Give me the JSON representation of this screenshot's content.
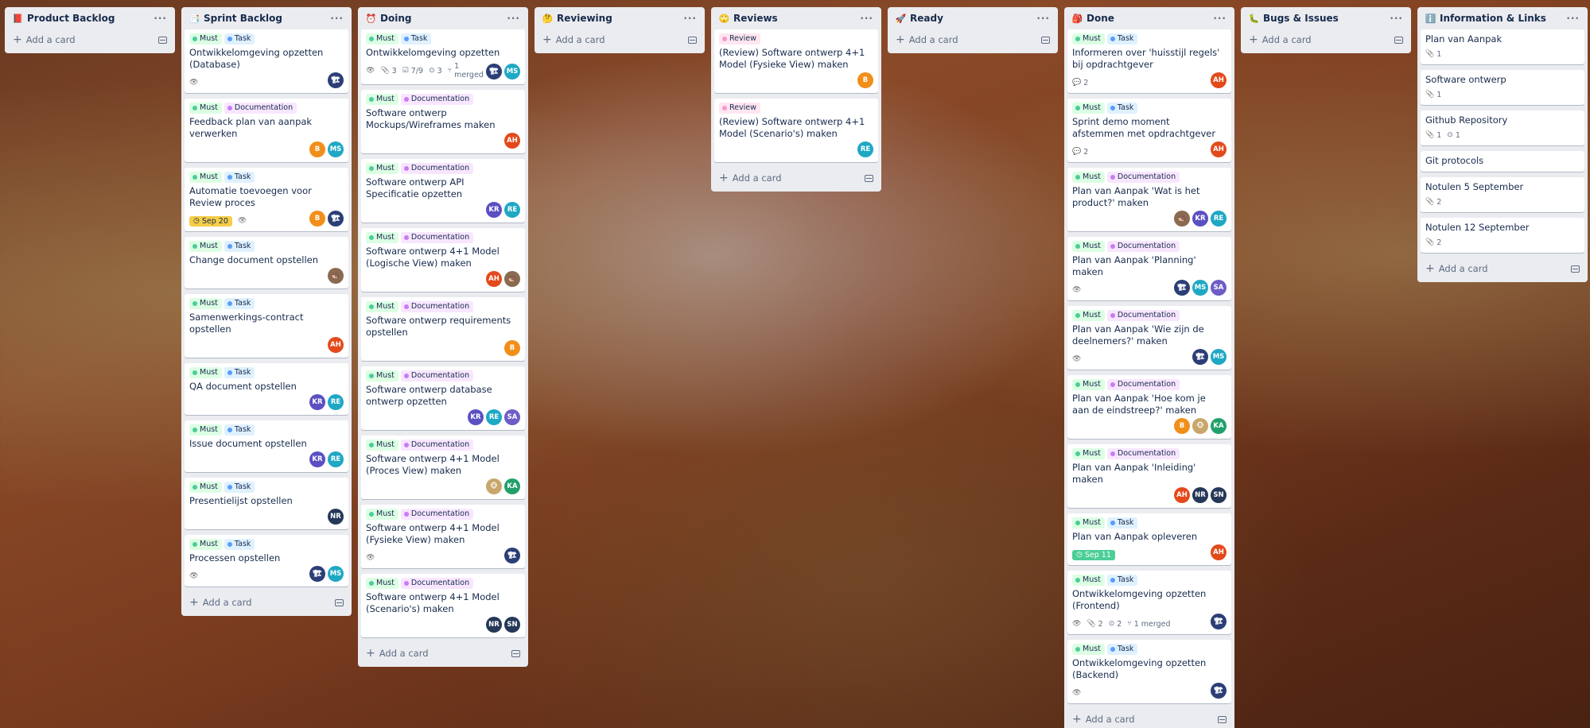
{
  "colors": {
    "must": "#4bce97",
    "task": "#579dff",
    "documentation": "#c97cf4",
    "review": "#f797d2"
  },
  "add_card_label": "Add a card",
  "lists": [
    {
      "title": "Product Backlog",
      "icon": "📕",
      "cards": []
    },
    {
      "title": "Sprint Backlog",
      "icon": "📑",
      "cards": [
        {
          "labels": [
            "Must",
            "Task"
          ],
          "title": "Ontwikkelomgeving opzetten (Database)",
          "badges": {
            "watch": true
          },
          "members": [
            {
              "i": "🏗",
              "c": "#2c3e76"
            }
          ]
        },
        {
          "labels": [
            "Must",
            "Documentation"
          ],
          "title": "Feedback plan van aanpak verwerken",
          "badges": {},
          "members": [
            {
              "i": "B",
              "c": "#f18f1a"
            },
            {
              "i": "MS",
              "c": "#1fa8c4"
            }
          ]
        },
        {
          "labels": [
            "Must",
            "Task"
          ],
          "title": "Automatie toevoegen voor Review proces",
          "badges": {
            "watch": true,
            "due": "Sep 20",
            "due_color": "yellow"
          },
          "members": [
            {
              "i": "B",
              "c": "#f18f1a"
            },
            {
              "i": "🏗",
              "c": "#2c3e76"
            }
          ]
        },
        {
          "labels": [
            "Must",
            "Task"
          ],
          "title": "Change document opstellen",
          "badges": {},
          "members": [
            {
              "i": "🦔",
              "c": "#8a6a50"
            }
          ]
        },
        {
          "labels": [
            "Must",
            "Task"
          ],
          "title": "Samenwerkings-contract opstellen",
          "badges": {},
          "members": [
            {
              "i": "AH",
              "c": "#e34a1b"
            }
          ]
        },
        {
          "labels": [
            "Must",
            "Task"
          ],
          "title": "QA document opstellen",
          "badges": {},
          "members": [
            {
              "i": "KR",
              "c": "#5b4fc2"
            },
            {
              "i": "RE",
              "c": "#1fa8c4"
            }
          ]
        },
        {
          "labels": [
            "Must",
            "Task"
          ],
          "title": "Issue document opstellen",
          "badges": {},
          "members": [
            {
              "i": "KR",
              "c": "#5b4fc2"
            },
            {
              "i": "RE",
              "c": "#1fa8c4"
            }
          ]
        },
        {
          "labels": [
            "Must",
            "Task"
          ],
          "title": "Presentielijst opstellen",
          "badges": {},
          "members": [
            {
              "i": "NR",
              "c": "#253858"
            }
          ]
        },
        {
          "labels": [
            "Must",
            "Task"
          ],
          "title": "Processen opstellen",
          "badges": {
            "watch": true
          },
          "members": [
            {
              "i": "🏗",
              "c": "#2c3e76"
            },
            {
              "i": "MS",
              "c": "#1fa8c4"
            }
          ]
        }
      ]
    },
    {
      "title": "Doing",
      "icon": "⏰",
      "cards": [
        {
          "labels": [
            "Must",
            "Task"
          ],
          "title": "Ontwikkelomgeving opzetten",
          "badges": {
            "watch": true,
            "attachments": "3",
            "checklist": "7/9",
            "github": "3",
            "merged": "1 merged"
          },
          "members": [
            {
              "i": "🏗",
              "c": "#2c3e76"
            },
            {
              "i": "MS",
              "c": "#1fa8c4"
            }
          ]
        },
        {
          "labels": [
            "Must",
            "Documentation"
          ],
          "title": "Software ontwerp Mockups/Wireframes maken",
          "badges": {},
          "members": [
            {
              "i": "AH",
              "c": "#e34a1b"
            }
          ]
        },
        {
          "labels": [
            "Must",
            "Documentation"
          ],
          "title": "Software ontwerp API Specificatie opzetten",
          "badges": {},
          "members": [
            {
              "i": "KR",
              "c": "#5b4fc2"
            },
            {
              "i": "RE",
              "c": "#1fa8c4"
            }
          ]
        },
        {
          "labels": [
            "Must",
            "Documentation"
          ],
          "title": "Software ontwerp 4+1 Model (Logische View) maken",
          "badges": {},
          "members": [
            {
              "i": "AH",
              "c": "#e34a1b"
            },
            {
              "i": "🦔",
              "c": "#8a6a50"
            }
          ]
        },
        {
          "labels": [
            "Must",
            "Documentation"
          ],
          "title": "Software ontwerp requirements opstellen",
          "badges": {},
          "members": [
            {
              "i": "B",
              "c": "#f18f1a"
            }
          ]
        },
        {
          "labels": [
            "Must",
            "Documentation"
          ],
          "title": "Software ontwerp database ontwerp opzetten",
          "badges": {},
          "members": [
            {
              "i": "KR",
              "c": "#5b4fc2"
            },
            {
              "i": "RE",
              "c": "#1fa8c4"
            },
            {
              "i": "SA",
              "c": "#6e5dc6"
            }
          ]
        },
        {
          "labels": [
            "Must",
            "Documentation"
          ],
          "title": "Software ontwerp 4+1 Model (Proces View) maken",
          "badges": {},
          "members": [
            {
              "i": "🐵",
              "c": "#c9a66b"
            },
            {
              "i": "KA",
              "c": "#22a06b"
            }
          ]
        },
        {
          "labels": [
            "Must",
            "Documentation"
          ],
          "title": "Software ontwerp 4+1 Model (Fysieke View) maken",
          "badges": {
            "watch": true
          },
          "members": [
            {
              "i": "🏗",
              "c": "#2c3e76"
            }
          ]
        },
        {
          "labels": [
            "Must",
            "Documentation"
          ],
          "title": "Software ontwerp 4+1 Model (Scenario's) maken",
          "badges": {},
          "members": [
            {
              "i": "NR",
              "c": "#253858"
            },
            {
              "i": "SN",
              "c": "#253858"
            }
          ]
        }
      ]
    },
    {
      "title": "Reviewing",
      "icon": "🤔",
      "cards": []
    },
    {
      "title": "Reviews",
      "icon": "🙄",
      "cards": [
        {
          "labels": [
            "Review"
          ],
          "title": "(Review) Software ontwerp 4+1 Model (Fysieke View) maken",
          "badges": {},
          "members": [
            {
              "i": "B",
              "c": "#f18f1a"
            }
          ]
        },
        {
          "labels": [
            "Review"
          ],
          "title": "(Review) Software ontwerp 4+1 Model (Scenario's) maken",
          "badges": {},
          "members": [
            {
              "i": "RE",
              "c": "#1fa8c4"
            }
          ]
        }
      ]
    },
    {
      "title": "Ready",
      "icon": "🚀",
      "cards": []
    },
    {
      "title": "Done",
      "icon": "🎒",
      "cards": [
        {
          "labels": [
            "Must",
            "Task"
          ],
          "title": "Informeren over 'huisstijl regels' bij opdrachtgever",
          "badges": {
            "comments": "2"
          },
          "members": [
            {
              "i": "AH",
              "c": "#e34a1b"
            }
          ]
        },
        {
          "labels": [
            "Must",
            "Task"
          ],
          "title": "Sprint demo moment afstemmen met opdrachtgever",
          "badges": {
            "comments": "2"
          },
          "members": [
            {
              "i": "AH",
              "c": "#e34a1b"
            }
          ]
        },
        {
          "labels": [
            "Must",
            "Documentation"
          ],
          "title": "Plan van Aanpak 'Wat is het product?' maken",
          "badges": {},
          "members": [
            {
              "i": "🦔",
              "c": "#8a6a50"
            },
            {
              "i": "KR",
              "c": "#5b4fc2"
            },
            {
              "i": "RE",
              "c": "#1fa8c4"
            }
          ]
        },
        {
          "labels": [
            "Must",
            "Documentation"
          ],
          "title": "Plan van Aanpak 'Planning' maken",
          "badges": {
            "watch": true
          },
          "members": [
            {
              "i": "🏗",
              "c": "#2c3e76"
            },
            {
              "i": "MS",
              "c": "#1fa8c4"
            },
            {
              "i": "SA",
              "c": "#6e5dc6"
            }
          ]
        },
        {
          "labels": [
            "Must",
            "Documentation"
          ],
          "title": "Plan van Aanpak 'Wie zijn de deelnemers?' maken",
          "badges": {
            "watch": true
          },
          "members": [
            {
              "i": "🏗",
              "c": "#2c3e76"
            },
            {
              "i": "MS",
              "c": "#1fa8c4"
            }
          ]
        },
        {
          "labels": [
            "Must",
            "Documentation"
          ],
          "title": "Plan van Aanpak 'Hoe kom je aan de eindstreep?' maken",
          "badges": {},
          "members": [
            {
              "i": "B",
              "c": "#f18f1a"
            },
            {
              "i": "🐵",
              "c": "#c9a66b"
            },
            {
              "i": "KA",
              "c": "#22a06b"
            }
          ]
        },
        {
          "labels": [
            "Must",
            "Documentation"
          ],
          "title": "Plan van Aanpak 'Inleiding' maken",
          "badges": {},
          "members": [
            {
              "i": "AH",
              "c": "#e34a1b"
            },
            {
              "i": "NR",
              "c": "#253858"
            },
            {
              "i": "SN",
              "c": "#253858"
            }
          ]
        },
        {
          "labels": [
            "Must",
            "Task"
          ],
          "title": "Plan van Aanpak opleveren",
          "badges": {
            "due": "Sep 11",
            "due_color": "green"
          },
          "members": [
            {
              "i": "AH",
              "c": "#e34a1b"
            }
          ]
        },
        {
          "labels": [
            "Must",
            "Task"
          ],
          "title": "Ontwikkelomgeving opzetten (Frontend)",
          "badges": {
            "watch": true,
            "attachments": "2",
            "github": "2",
            "merged": "1 merged"
          },
          "members": [
            {
              "i": "🏗",
              "c": "#2c3e76"
            }
          ]
        },
        {
          "labels": [
            "Must",
            "Task"
          ],
          "title": "Ontwikkelomgeving opzetten (Backend)",
          "badges": {
            "watch": true
          },
          "members": [
            {
              "i": "🏗",
              "c": "#2c3e76"
            }
          ]
        }
      ]
    },
    {
      "title": "Bugs & Issues",
      "icon": "🐛",
      "cards": []
    },
    {
      "title": "Information & Links",
      "icon": "ℹ️",
      "cards": [
        {
          "labels": [],
          "title": "Plan van Aanpak",
          "badges": {
            "attachments": "1"
          },
          "members": []
        },
        {
          "labels": [],
          "title": "Software ontwerp",
          "badges": {
            "attachments": "1"
          },
          "members": []
        },
        {
          "labels": [],
          "title": "Github Repository",
          "badges": {
            "attachments": "1",
            "github": "1"
          },
          "members": []
        },
        {
          "labels": [],
          "title": "Git protocols",
          "badges": {},
          "members": []
        },
        {
          "labels": [],
          "title": "Notulen 5 September",
          "badges": {
            "attachments": "2"
          },
          "members": []
        },
        {
          "labels": [],
          "title": "Notulen 12 September",
          "badges": {
            "attachments": "2"
          },
          "members": []
        }
      ]
    }
  ]
}
